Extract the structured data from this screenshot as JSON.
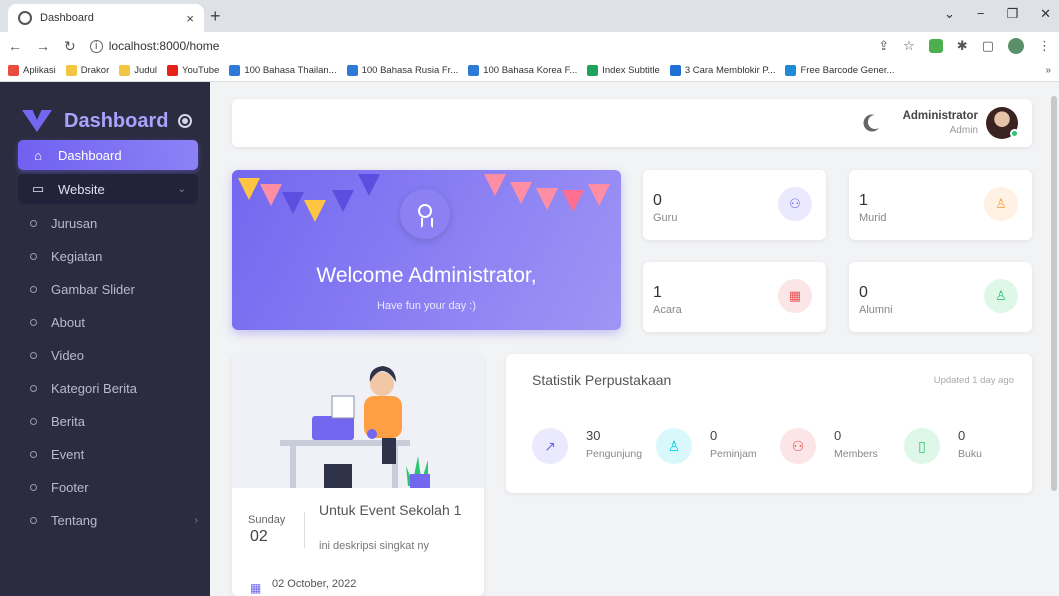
{
  "browser": {
    "tab_title": "Dashboard",
    "tab_close": "×",
    "new_tab": "+",
    "url": "localhost:8000/home",
    "bookmarks": [
      {
        "label": "Aplikasi",
        "color": "#e84c3d"
      },
      {
        "label": "Drakor",
        "color": "#f4c542"
      },
      {
        "label": "Judul",
        "color": "#f4c542"
      },
      {
        "label": "YouTube",
        "color": "#e62117"
      },
      {
        "label": "100 Bahasa Thailan...",
        "color": "#2d7bd6"
      },
      {
        "label": "100 Bahasa Rusia Fr...",
        "color": "#2d7bd6"
      },
      {
        "label": "100 Bahasa Korea F...",
        "color": "#2d7bd6"
      },
      {
        "label": "Index Subtitle",
        "color": "#1fa35c"
      },
      {
        "label": "3 Cara Memblokir P...",
        "color": "#1f6fd6"
      },
      {
        "label": "Free Barcode Gener...",
        "color": "#1f8bd6"
      }
    ],
    "bookmarks_more": "»"
  },
  "sidebar": {
    "brand": "Dashboard",
    "items": [
      {
        "label": "Dashboard",
        "icon": "home-icon"
      },
      {
        "label": "Website",
        "icon": "window-icon"
      }
    ],
    "subitems": [
      "Jurusan",
      "Kegiatan",
      "Gambar Slider",
      "About",
      "Video",
      "Kategori Berita",
      "Berita",
      "Event",
      "Footer",
      "Tentang"
    ]
  },
  "navbar": {
    "user_name": "Administrator",
    "user_role": "Admin"
  },
  "welcome": {
    "title": "Welcome Administrator,",
    "subtitle": "Have fun your day :)"
  },
  "stats": [
    {
      "value": "0",
      "label": "Guru",
      "icon": "users-icon",
      "color": "#7367f0",
      "bg": "#ebe9fd"
    },
    {
      "value": "1",
      "label": "Murid",
      "icon": "user-check-icon",
      "color": "#ff9f43",
      "bg": "#fff1e3"
    },
    {
      "value": "1",
      "label": "Acara",
      "icon": "calendar-icon",
      "color": "#ea5455",
      "bg": "#fce5e6"
    },
    {
      "value": "0",
      "label": "Alumni",
      "icon": "user-icon",
      "color": "#28c76f",
      "bg": "#dff7e9"
    }
  ],
  "event": {
    "day": "Sunday",
    "date": "02",
    "title": "Untuk Event Sekolah 1",
    "description": "ini deskripsi singkat ny",
    "full_date": "02 October, 2022"
  },
  "library": {
    "title": "Statistik Perpustakaan",
    "updated": "Updated 1 day ago",
    "stats": [
      {
        "value": "30",
        "label": "Pengunjung",
        "icon": "trending-up-icon",
        "color": "#7367f0",
        "bg": "#ebe9fd"
      },
      {
        "value": "0",
        "label": "Peminjam",
        "icon": "user-icon",
        "color": "#00cfe8",
        "bg": "#d9f8fc"
      },
      {
        "value": "0",
        "label": "Members",
        "icon": "users-icon",
        "color": "#ea5455",
        "bg": "#fce5e6"
      },
      {
        "value": "0",
        "label": "Buku",
        "icon": "book-icon",
        "color": "#28c76f",
        "bg": "#dff7e9"
      }
    ]
  }
}
